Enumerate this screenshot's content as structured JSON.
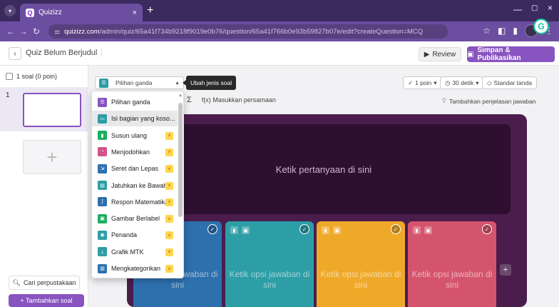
{
  "browser": {
    "tab_title": "Quizizz",
    "url_host": "quizizz.com",
    "url_path": "/admin/quiz/65a41f734b9218f9019e0b76/question/65a41f766b0e93b59827b07e/edit?createQuestion=MCQ"
  },
  "header": {
    "quiz_title": "Quiz Belum Berjudul",
    "review_label": "Review",
    "publish_label": "Simpan & Publikasikan"
  },
  "sidebar": {
    "question_count": "1 soal (0 poin)",
    "question_number": "1",
    "library_label": "Cari perpustakaan",
    "add_question_label": "+ Tambahkan soal"
  },
  "toolbar": {
    "question_type": "Pilihan ganda",
    "tooltip": "Ubah jenis soal",
    "points": "1 poin",
    "time": "30 detik",
    "standard": "Standar tanda",
    "equation_label": "Masukkan persamaan",
    "explanation_label": "Tambahkan penjelasan jawaban"
  },
  "question": {
    "placeholder": "Ketik pertanyaan di sini"
  },
  "options": [
    {
      "text": "Ketik opsi jawaban di sini",
      "color": "#2d70ae"
    },
    {
      "text": "Ketik opsi jawaban di sini",
      "color": "#2d9da6"
    },
    {
      "text": "Ketik opsi jawaban di sini",
      "color": "#efa929"
    },
    {
      "text": "Ketik opsi jawaban di sini",
      "color": "#d5546d"
    }
  ],
  "dropdown": {
    "items": [
      {
        "label": "Pilihan ganda",
        "color": "#8854c0",
        "pro": false,
        "icon": "list-icon"
      },
      {
        "label": "Isi bagian yang koso...",
        "color": "#2d9da6",
        "pro": false,
        "icon": "blank-icon"
      },
      {
        "label": "Susun ulang",
        "color": "#1bae5f",
        "pro": true,
        "icon": "bars-icon"
      },
      {
        "label": "Menjodohkan",
        "color": "#d1548c",
        "pro": true,
        "icon": "match-icon"
      },
      {
        "label": "Seret dan Lepas",
        "color": "#2d70ae",
        "pro": true,
        "icon": "drag-icon"
      },
      {
        "label": "Jatuhkan ke Bawah",
        "color": "#2d9da6",
        "pro": true,
        "icon": "dropdown-icon"
      },
      {
        "label": "Respon Matematika",
        "color": "#2d70ae",
        "pro": true,
        "icon": "math-icon"
      },
      {
        "label": "Gambar Berlabel",
        "color": "#1bae5f",
        "pro": true,
        "icon": "image-icon"
      },
      {
        "label": "Penanda",
        "color": "#2d9da6",
        "pro": true,
        "icon": "marker-icon"
      },
      {
        "label": "Grafik MTK",
        "color": "#2d9da6",
        "pro": true,
        "icon": "graph-icon"
      },
      {
        "label": "Mengkategorikan",
        "color": "#2d70ae",
        "pro": true,
        "icon": "category-icon"
      }
    ]
  }
}
